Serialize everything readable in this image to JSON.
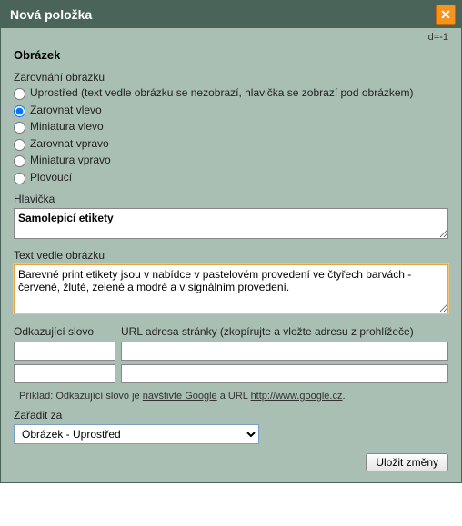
{
  "window": {
    "title": "Nová položka",
    "id_text": "id=-1"
  },
  "section": {
    "heading": "Obrázek"
  },
  "align": {
    "label": "Zarovnání obrázku",
    "options": [
      {
        "label": "Uprostřed (text vedle obrázku se nezobrazí, hlavička se zobrazí pod obrázkem)",
        "checked": false
      },
      {
        "label": "Zarovnat vlevo",
        "checked": true
      },
      {
        "label": "Miniatura vlevo",
        "checked": false
      },
      {
        "label": "Zarovnat vpravo",
        "checked": false
      },
      {
        "label": "Miniatura vpravo",
        "checked": false
      },
      {
        "label": "Plovoucí",
        "checked": false
      }
    ]
  },
  "heading_field": {
    "label": "Hlavička",
    "value": "Samolepicí etikety"
  },
  "body_field": {
    "label": "Text vedle obrázku",
    "value": "Barevné print etikety jsou v nabídce v pastelovém provedení ve čtyřech barvách - červené, žluté, zelené a modré a v signálním provedení."
  },
  "links": {
    "word_label": "Odkazující slovo",
    "url_label": "URL adresa stránky (zkopírujte a vložte adresu z prohlížeče)",
    "rows": [
      {
        "word": "",
        "url": ""
      },
      {
        "word": "",
        "url": ""
      }
    ],
    "example_prefix": "Příklad: Odkazující slovo je ",
    "example_link1_text": "navštivte Google",
    "example_mid": " a URL ",
    "example_link2_text": "http://www.google.cz",
    "example_suffix": "."
  },
  "order": {
    "label": "Zařadit za",
    "selected": "Obrázek - Uprostřed"
  },
  "buttons": {
    "save": "Uložit změny"
  }
}
